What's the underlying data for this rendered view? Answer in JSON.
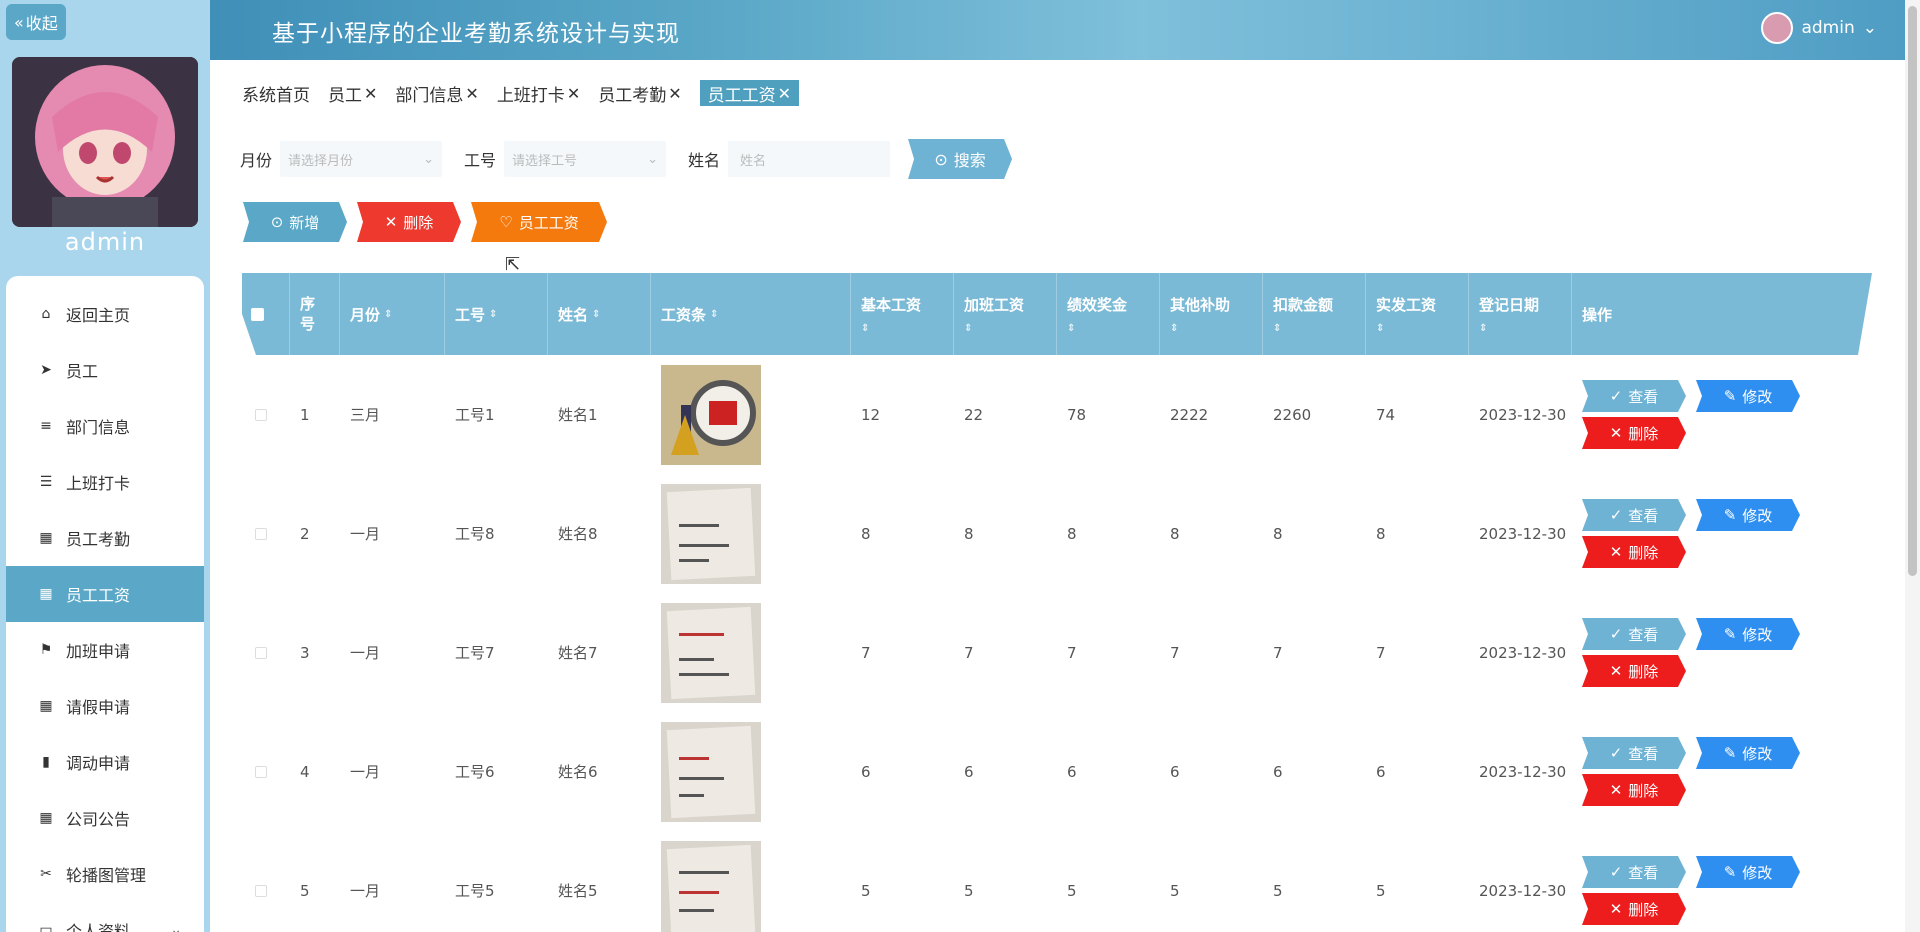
{
  "app": {
    "title": "基于小程序的企业考勤系统设计与实现",
    "user": "admin"
  },
  "sidebar": {
    "collapse_label": "收起",
    "username": "admin",
    "items": [
      {
        "label": "返回主页",
        "icon": "home-icon"
      },
      {
        "label": "员工",
        "icon": "send-icon"
      },
      {
        "label": "部门信息",
        "icon": "list-icon"
      },
      {
        "label": "上班打卡",
        "icon": "list-icon"
      },
      {
        "label": "员工考勤",
        "icon": "grid-icon"
      },
      {
        "label": "员工工资",
        "icon": "grid-icon",
        "active": true
      },
      {
        "label": "加班申请",
        "icon": "flag-icon"
      },
      {
        "label": "请假申请",
        "icon": "grid-icon"
      },
      {
        "label": "调动申请",
        "icon": "bar-chart-icon"
      },
      {
        "label": "公司公告",
        "icon": "grid-icon"
      },
      {
        "label": "轮播图管理",
        "icon": "film-icon"
      },
      {
        "label": "个人资料",
        "icon": "wallet-icon"
      }
    ]
  },
  "tabs": [
    {
      "label": "系统首页",
      "closable": false
    },
    {
      "label": "员工",
      "closable": true
    },
    {
      "label": "部门信息",
      "closable": true
    },
    {
      "label": "上班打卡",
      "closable": true
    },
    {
      "label": "员工考勤",
      "closable": true
    },
    {
      "label": "员工工资",
      "closable": true,
      "active": true
    }
  ],
  "search": {
    "month_label": "月份",
    "month_placeholder": "请选择月份",
    "id_label": "工号",
    "id_placeholder": "请选择工号",
    "name_label": "姓名",
    "name_placeholder": "姓名",
    "button": "搜索"
  },
  "actions": {
    "add": "新增",
    "delete": "删除",
    "salary": "员工工资"
  },
  "table": {
    "headers": {
      "index": "序号",
      "month": "月份",
      "id": "工号",
      "name": "姓名",
      "slip": "工资条",
      "base": "基本工资",
      "overtime": "加班工资",
      "bonus": "绩效奖金",
      "other": "其他补助",
      "deduct": "扣款金额",
      "net": "实发工资",
      "date": "登记日期",
      "ops": "操作"
    },
    "ops_labels": {
      "view": "查看",
      "edit": "修改",
      "delete": "删除"
    },
    "rows": [
      {
        "index": "1",
        "month": "三月",
        "id": "工号1",
        "name": "姓名1",
        "base": "12",
        "overtime": "22",
        "bonus": "78",
        "other": "2222",
        "deduct": "2260",
        "net": "74",
        "date": "2023-12-30"
      },
      {
        "index": "2",
        "month": "一月",
        "id": "工号8",
        "name": "姓名8",
        "base": "8",
        "overtime": "8",
        "bonus": "8",
        "other": "8",
        "deduct": "8",
        "net": "8",
        "date": "2023-12-30"
      },
      {
        "index": "3",
        "month": "一月",
        "id": "工号7",
        "name": "姓名7",
        "base": "7",
        "overtime": "7",
        "bonus": "7",
        "other": "7",
        "deduct": "7",
        "net": "7",
        "date": "2023-12-30"
      },
      {
        "index": "4",
        "month": "一月",
        "id": "工号6",
        "name": "姓名6",
        "base": "6",
        "overtime": "6",
        "bonus": "6",
        "other": "6",
        "deduct": "6",
        "net": "6",
        "date": "2023-12-30"
      },
      {
        "index": "5",
        "month": "一月",
        "id": "工号5",
        "name": "姓名5",
        "base": "5",
        "overtime": "5",
        "bonus": "5",
        "other": "5",
        "deduct": "5",
        "net": "5",
        "date": "2023-12-30"
      }
    ]
  }
}
